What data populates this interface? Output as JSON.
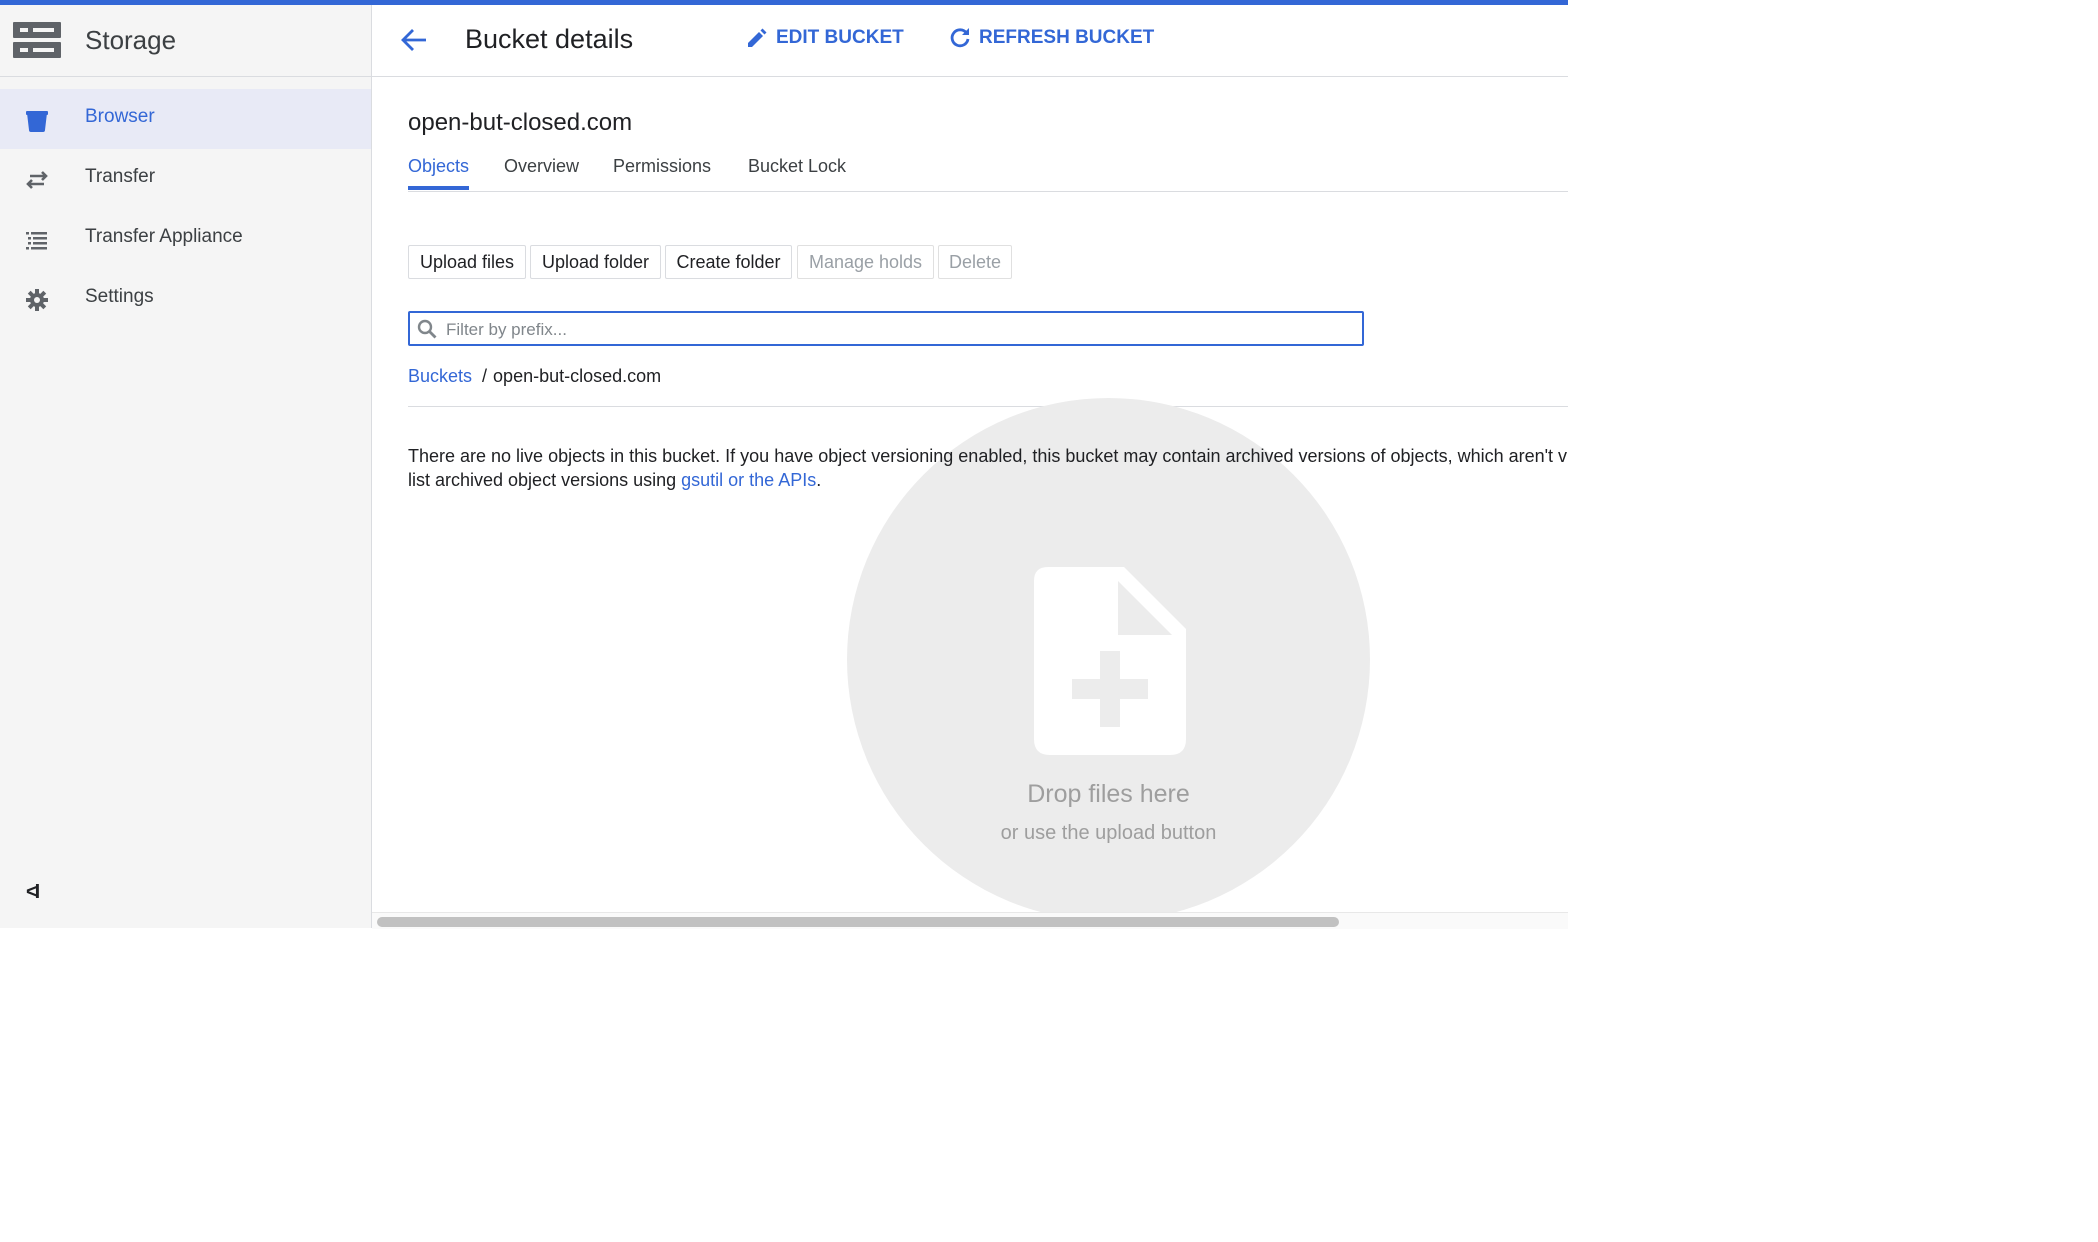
{
  "colors": {
    "accent": "#3367d6",
    "sidebar_bg": "#f5f5f5",
    "active_bg": "#e8eaf6",
    "dropzone_bg": "#ececec"
  },
  "sidebar": {
    "title": "Storage",
    "items": [
      {
        "label": "Browser",
        "icon": "bucket-icon",
        "active": true
      },
      {
        "label": "Transfer",
        "icon": "transfer-arrows-icon",
        "active": false
      },
      {
        "label": "Transfer Appliance",
        "icon": "list-icon",
        "active": false
      },
      {
        "label": "Settings",
        "icon": "gear-icon",
        "active": false
      }
    ],
    "collapse_label": "<I"
  },
  "header": {
    "title": "Bucket details",
    "edit_label": "EDIT BUCKET",
    "refresh_label": "REFRESH BUCKET"
  },
  "bucket": {
    "name": "open-but-closed.com"
  },
  "tabs": [
    "Objects",
    "Overview",
    "Permissions",
    "Bucket Lock"
  ],
  "active_tab": "Objects",
  "toolbar": {
    "upload_files": "Upload files",
    "upload_folder": "Upload folder",
    "create_folder": "Create folder",
    "manage_holds": "Manage holds",
    "delete": "Delete"
  },
  "filter": {
    "placeholder": "Filter by prefix...",
    "value": ""
  },
  "breadcrumb": {
    "root": "Buckets",
    "separator": "/",
    "current": "open-but-closed.com"
  },
  "message": {
    "line1": "There are no live objects in this bucket. If you have object versioning enabled, this bucket may contain archived versions of objects, which aren't vis",
    "line2_prefix": "list archived object versions using ",
    "link": "gsutil or the APIs",
    "line2_suffix": "."
  },
  "dropzone": {
    "title": "Drop files here",
    "subtitle": "or use the upload button"
  }
}
